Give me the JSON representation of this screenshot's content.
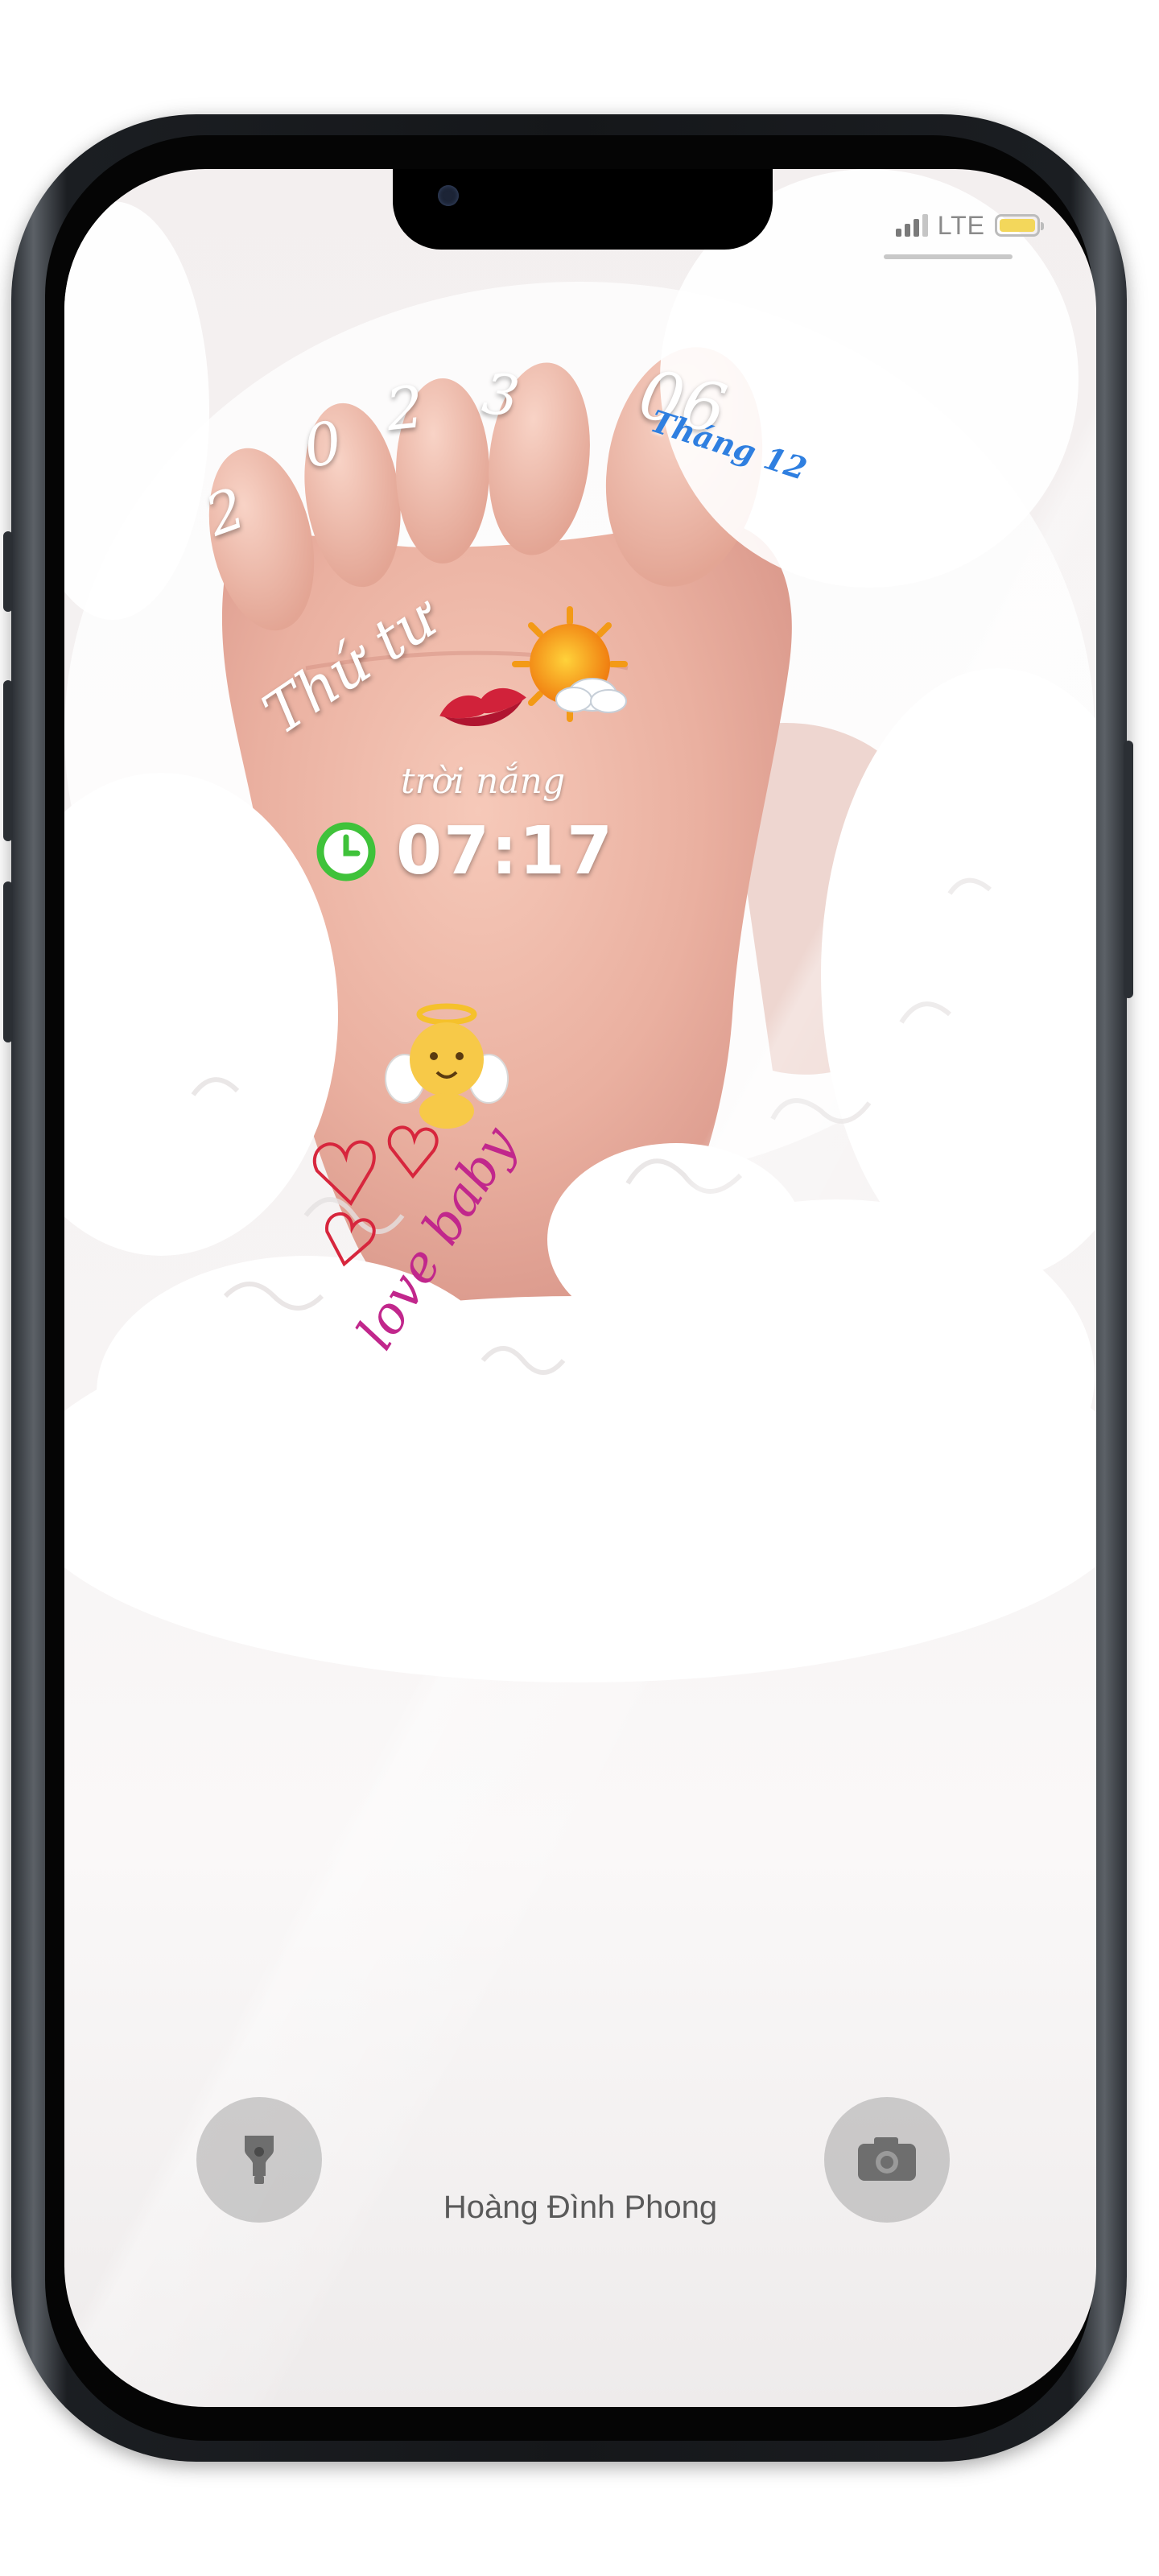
{
  "status_bar": {
    "network": "LTE"
  },
  "lock_screen": {
    "year_digits": [
      "2",
      "0",
      "2",
      "3"
    ],
    "day": "06",
    "month_label": "Tháng 12",
    "weekday": "Thứ tư",
    "weather_label": "trời nắng",
    "time": "07:17",
    "caption": "love baby",
    "owner_name": "Hoàng Đình Phong"
  },
  "icons": [
    "kiss-icon",
    "sun-cloud-icon",
    "clock-icon",
    "angel-baby-icon",
    "hearts-icon",
    "flashlight-icon",
    "camera-icon"
  ]
}
